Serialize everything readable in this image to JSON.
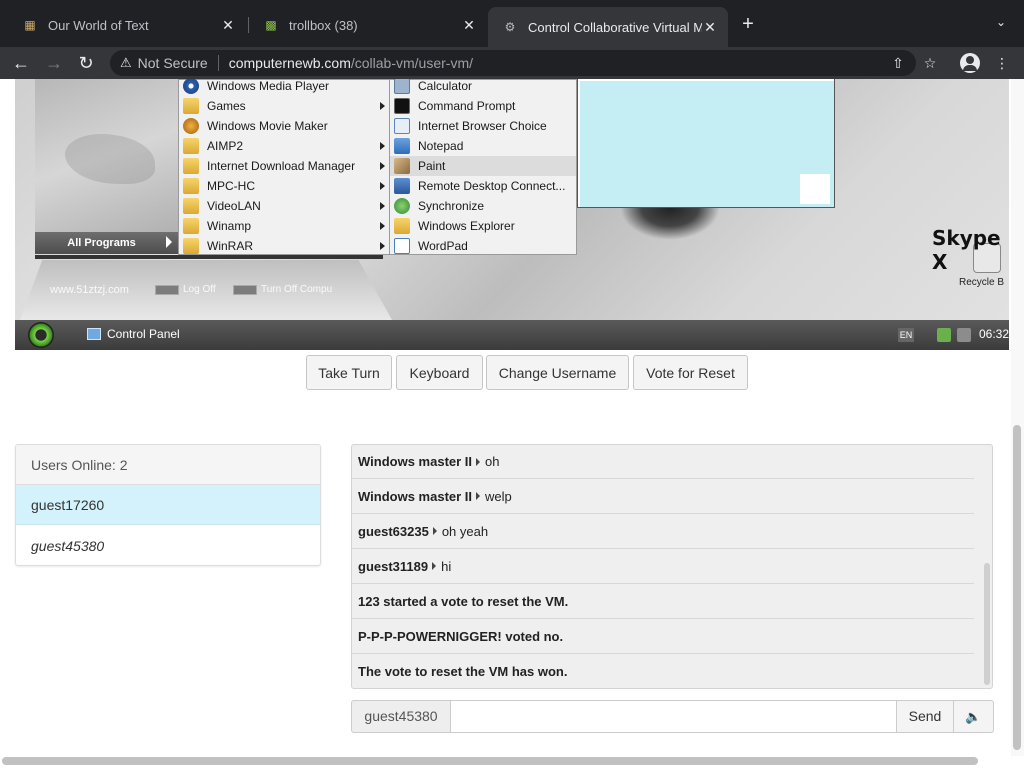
{
  "browser": {
    "tabs": [
      {
        "title": "Our World of Text",
        "icon": "world-favicon"
      },
      {
        "title": "trollbox (38)",
        "icon": "trollbox-favicon"
      },
      {
        "title": "Control Collaborative Virtual M",
        "icon": "collabvm-favicon"
      }
    ],
    "security_label": "Not Secure",
    "url_host": "computernewb.com",
    "url_path": "/collab-vm/user-vm/"
  },
  "vm": {
    "programs_menu": [
      {
        "label": "Windows Media Player",
        "icon": "media-player-icon",
        "submenu": false
      },
      {
        "label": "Games",
        "icon": "folder-icon",
        "submenu": true
      },
      {
        "label": "Windows Movie Maker",
        "icon": "movie-maker-icon",
        "submenu": false
      },
      {
        "label": "AIMP2",
        "icon": "folder-icon",
        "submenu": true
      },
      {
        "label": "Internet Download Manager",
        "icon": "folder-icon",
        "submenu": true
      },
      {
        "label": "MPC-HC",
        "icon": "folder-icon",
        "submenu": true
      },
      {
        "label": "VideoLAN",
        "icon": "folder-icon",
        "submenu": true
      },
      {
        "label": "Winamp",
        "icon": "folder-icon",
        "submenu": true
      },
      {
        "label": "WinRAR",
        "icon": "folder-icon",
        "submenu": true
      }
    ],
    "accessories_menu": [
      {
        "label": "Calculator",
        "icon": "calculator-icon"
      },
      {
        "label": "Command Prompt",
        "icon": "command-prompt-icon"
      },
      {
        "label": "Internet Browser Choice",
        "icon": "browser-choice-icon"
      },
      {
        "label": "Notepad",
        "icon": "notepad-icon"
      },
      {
        "label": "Paint",
        "icon": "paint-icon",
        "highlighted": true
      },
      {
        "label": "Remote Desktop Connect...",
        "icon": "remote-desktop-icon"
      },
      {
        "label": "Synchronize",
        "icon": "synchronize-icon"
      },
      {
        "label": "Windows Explorer",
        "icon": "explorer-icon"
      },
      {
        "label": "WordPad",
        "icon": "wordpad-icon"
      }
    ],
    "all_programs": "All Programs",
    "watermark": "www.51ztzj.com",
    "log_off": "Log Off",
    "turn_off": "Turn Off Compu",
    "desktop_label": "Skype X",
    "recycle_bin": "Recycle B",
    "taskbar_item": "Control Panel",
    "language": "EN",
    "clock": "06:32"
  },
  "controls": {
    "take_turn": "Take Turn",
    "keyboard": "Keyboard",
    "change_username": "Change Username",
    "vote_reset": "Vote for Reset"
  },
  "users": {
    "header": "Users Online: 2",
    "list": [
      "guest17260",
      "guest45380"
    ]
  },
  "chat": {
    "messages": [
      {
        "user": "Windows master II",
        "text": "oh"
      },
      {
        "user": "Windows master II",
        "text": "welp"
      },
      {
        "user": "guest63235",
        "text": "oh yeah"
      },
      {
        "user": "guest31189",
        "text": "hi"
      },
      {
        "system": "123 started a vote to reset the VM."
      },
      {
        "system": "P-P-P-POWERNIGGER! voted no."
      },
      {
        "system": "The vote to reset the VM has won."
      }
    ],
    "username": "guest45380",
    "input_value": "",
    "send_label": "Send"
  }
}
